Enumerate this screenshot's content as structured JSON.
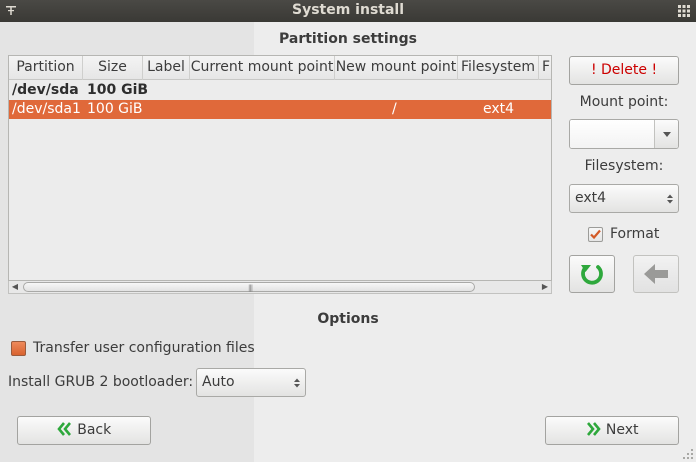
{
  "window": {
    "title": "System install"
  },
  "partition_section": {
    "title": "Partition settings"
  },
  "table": {
    "columns": [
      "Partition",
      "Size",
      "Label",
      "Current mount point",
      "New mount point",
      "Filesystem",
      "F"
    ],
    "rows": [
      {
        "partition": "/dev/sda",
        "size": "100 GiB",
        "label": "",
        "current_mount": "",
        "new_mount": "",
        "filesystem": "",
        "selected": false
      },
      {
        "partition": "/dev/sda1",
        "size": "100 GiB",
        "label": "",
        "current_mount": "",
        "new_mount": "/",
        "filesystem": "ext4",
        "selected": true
      }
    ]
  },
  "sidebar": {
    "delete_label": "! Delete !",
    "mount_point_label": "Mount point:",
    "mount_point_value": "",
    "filesystem_label": "Filesystem:",
    "filesystem_value": "ext4",
    "format_label": "Format",
    "format_checked": true
  },
  "options_section": {
    "title": "Options",
    "transfer_label": "Transfer user configuration files",
    "transfer_checked": false,
    "grub_label": "Install GRUB 2 bootloader:",
    "grub_value": "Auto"
  },
  "footer": {
    "back_label": "Back",
    "next_label": "Next"
  },
  "colors": {
    "accent": "#e0693a",
    "delete_text": "#cc0000",
    "nav_icon_green": "#2ea83c"
  },
  "icons": [
    "menu-icon",
    "grid-icon",
    "refresh-icon",
    "arrow-left-icon",
    "double-chevron-left-icon",
    "double-chevron-right-icon",
    "check-icon",
    "chevron-down-icon",
    "updown-icon",
    "resize-grip-icon"
  ]
}
